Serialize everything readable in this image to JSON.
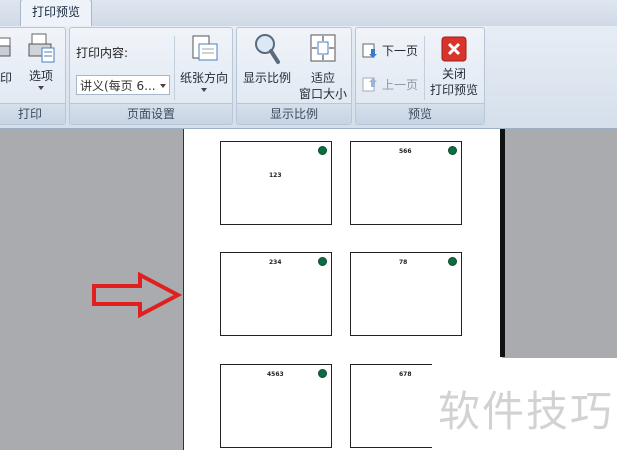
{
  "tabs": {
    "print_preview": "打印预览"
  },
  "groups": {
    "print": {
      "label": "打印",
      "print_button": "印",
      "options_button": "选项"
    },
    "page_setup": {
      "label": "页面设置",
      "print_content_label": "打印内容:",
      "print_content_value": "讲义(每页 6...",
      "orientation_button": "纸张方向"
    },
    "zoom": {
      "label": "显示比例",
      "zoom_button": "显示比例",
      "fit_line1": "适应",
      "fit_line2": "窗口大小"
    },
    "preview": {
      "label": "预览",
      "next_page": "下一页",
      "prev_page": "上一页",
      "close_line1": "关闭",
      "close_line2": "打印预览"
    }
  },
  "slides": [
    "123",
    "566",
    "234",
    "78",
    "4563",
    "678"
  ],
  "watermark": "软件技巧",
  "colors": {
    "arrow": "#e02020",
    "close_icon": "#d9342b",
    "logo": "#0f6b41"
  }
}
